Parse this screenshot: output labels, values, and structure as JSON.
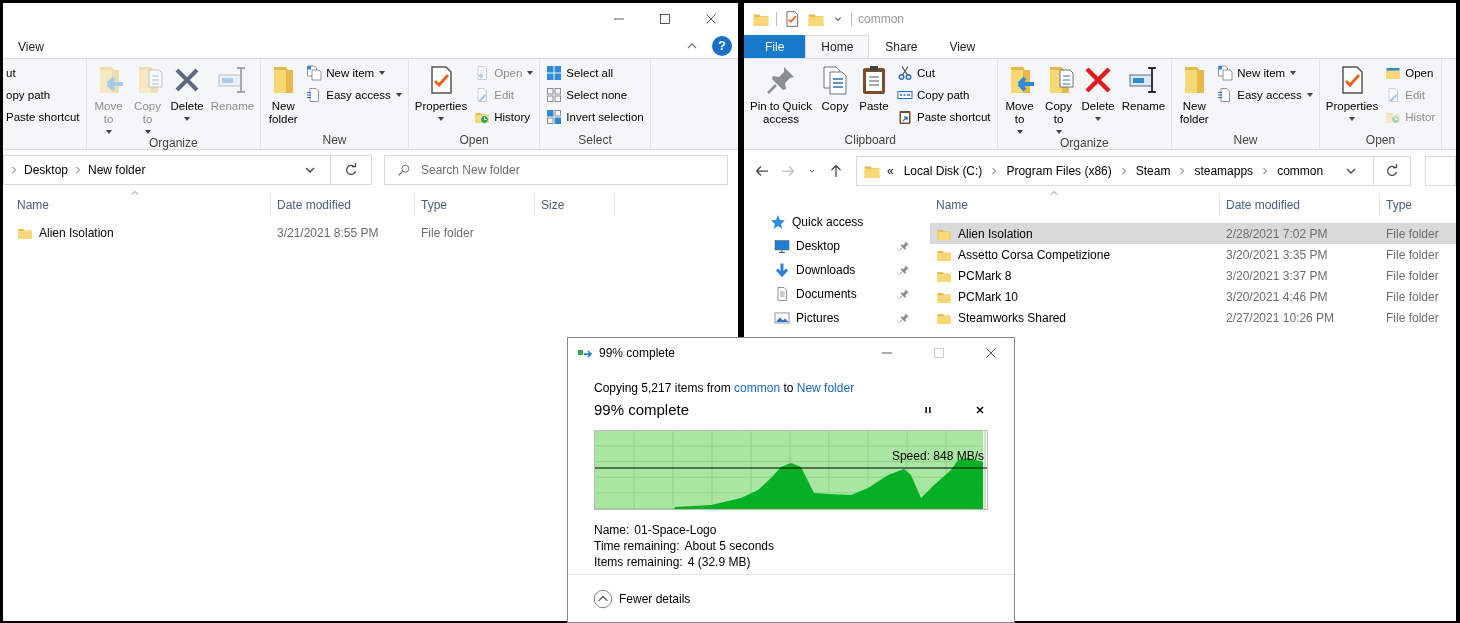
{
  "left_window": {
    "tabs": [
      {
        "label": "View",
        "selected": false
      }
    ],
    "help_label": "?",
    "ribbon_groups": [
      {
        "items": [
          {
            "kind": "small",
            "label": "ut",
            "disabled": false,
            "dropdown": false
          },
          {
            "kind": "small",
            "label": "opy path",
            "disabled": false,
            "dropdown": false
          },
          {
            "kind": "small",
            "label": "Paste shortcut",
            "disabled": false,
            "dropdown": false
          }
        ]
      },
      {
        "label": "Organize",
        "items": [
          {
            "kind": "large",
            "label": "Move\nto",
            "disabled": true,
            "dropdown": true
          },
          {
            "kind": "large",
            "label": "Copy\nto",
            "disabled": true,
            "dropdown": true
          },
          {
            "kind": "large",
            "label": "Delete",
            "disabled": false,
            "dropdown": true
          },
          {
            "kind": "large",
            "label": "Rename",
            "disabled": true,
            "dropdown": false
          }
        ]
      },
      {
        "label": "New",
        "items": [
          {
            "kind": "large",
            "label": "New\nfolder",
            "disabled": false,
            "dropdown": false
          },
          {
            "kind": "small",
            "label": "New item",
            "disabled": false,
            "dropdown": true
          },
          {
            "kind": "small",
            "label": "Easy access",
            "disabled": false,
            "dropdown": true
          }
        ]
      },
      {
        "label": "Open",
        "items": [
          {
            "kind": "large",
            "label": "Properties",
            "disabled": false,
            "dropdown": true
          },
          {
            "kind": "small",
            "label": "Open",
            "disabled": true,
            "dropdown": true
          },
          {
            "kind": "small",
            "label": "Edit",
            "disabled": true,
            "dropdown": false
          },
          {
            "kind": "small",
            "label": "History",
            "disabled": false,
            "dropdown": false
          }
        ]
      },
      {
        "label": "Select",
        "items": [
          {
            "kind": "small",
            "label": "Select all",
            "disabled": false,
            "dropdown": false
          },
          {
            "kind": "small",
            "label": "Select none",
            "disabled": false,
            "dropdown": false
          },
          {
            "kind": "small",
            "label": "Invert selection",
            "disabled": false,
            "dropdown": false
          }
        ]
      }
    ],
    "crumbs": [
      "Desktop",
      "New folder"
    ],
    "search": {
      "placeholder": "Search New folder"
    },
    "columns": [
      "Name",
      "Date modified",
      "Type",
      "Size"
    ],
    "rows": [
      {
        "name": "Alien Isolation",
        "date": "3/21/2021 8:55 PM",
        "type": "File folder",
        "selected": false
      }
    ]
  },
  "right_window": {
    "title": "common",
    "tabs": [
      {
        "label": "File",
        "kind": "file",
        "selected": false
      },
      {
        "label": "Home",
        "kind": "tab",
        "selected": true
      },
      {
        "label": "Share",
        "kind": "tab",
        "selected": false
      },
      {
        "label": "View",
        "kind": "tab",
        "selected": false
      }
    ],
    "ribbon_groups": [
      {
        "label": "Clipboard",
        "items": [
          {
            "kind": "large",
            "label": "Pin to Quick\naccess",
            "disabled": false,
            "dropdown": false
          },
          {
            "kind": "large",
            "label": "Copy",
            "disabled": false,
            "dropdown": false
          },
          {
            "kind": "large",
            "label": "Paste",
            "disabled": false,
            "dropdown": false
          },
          {
            "kind": "small",
            "label": "Cut",
            "disabled": false,
            "dropdown": false
          },
          {
            "kind": "small",
            "label": "Copy path",
            "disabled": false,
            "dropdown": false
          },
          {
            "kind": "small",
            "label": "Paste shortcut",
            "disabled": false,
            "dropdown": false
          }
        ]
      },
      {
        "label": "Organize",
        "items": [
          {
            "kind": "large",
            "label": "Move\nto",
            "disabled": false,
            "dropdown": true
          },
          {
            "kind": "large",
            "label": "Copy\nto",
            "disabled": false,
            "dropdown": true
          },
          {
            "kind": "large",
            "label": "Delete",
            "disabled": false,
            "dropdown": true
          },
          {
            "kind": "large",
            "label": "Rename",
            "disabled": false,
            "dropdown": false
          }
        ]
      },
      {
        "label": "New",
        "items": [
          {
            "kind": "large",
            "label": "New\nfolder",
            "disabled": false,
            "dropdown": false
          },
          {
            "kind": "small",
            "label": "New item",
            "disabled": false,
            "dropdown": true
          },
          {
            "kind": "small",
            "label": "Easy access",
            "disabled": false,
            "dropdown": true
          }
        ]
      },
      {
        "label": "Open",
        "items": [
          {
            "kind": "large",
            "label": "Properties",
            "disabled": false,
            "dropdown": true
          },
          {
            "kind": "small",
            "label": "Open",
            "disabled": false,
            "dropdown": false
          },
          {
            "kind": "small",
            "label": "Edit",
            "disabled": true,
            "dropdown": false
          },
          {
            "kind": "small",
            "label": "Histor",
            "disabled": true,
            "dropdown": false
          }
        ]
      }
    ],
    "nav_buttons": [
      {
        "kind": "back",
        "disabled": false
      },
      {
        "kind": "forward",
        "disabled": true
      },
      {
        "kind": "recent",
        "disabled": false
      },
      {
        "kind": "up",
        "disabled": false
      }
    ],
    "overflow_label": "«",
    "crumbs": [
      "Local Disk (C:)",
      "Program Files (x86)",
      "Steam",
      "steamapps",
      "common"
    ],
    "sidebar": {
      "header": "Quick access",
      "items": [
        {
          "label": "Desktop",
          "pinned": true
        },
        {
          "label": "Downloads",
          "pinned": true
        },
        {
          "label": "Documents",
          "pinned": true
        },
        {
          "label": "Pictures",
          "pinned": true
        }
      ]
    },
    "columns": [
      "Name",
      "Date modified",
      "Type"
    ],
    "rows": [
      {
        "name": "Alien Isolation",
        "date": "2/28/2021 7:02 PM",
        "type": "File folder",
        "selected": true
      },
      {
        "name": "Assetto Corsa Competizione",
        "date": "3/20/2021 3:35 PM",
        "type": "File folder",
        "selected": false
      },
      {
        "name": "PCMark 8",
        "date": "3/20/2021 3:37 PM",
        "type": "File folder",
        "selected": false
      },
      {
        "name": "PCMark 10",
        "date": "3/20/2021 4:46 PM",
        "type": "File folder",
        "selected": false
      },
      {
        "name": "Steamworks Shared",
        "date": "2/27/2021 10:26 PM",
        "type": "File folder",
        "selected": false
      }
    ]
  },
  "copy_dialog": {
    "title": "99% complete",
    "maximize_disabled": true,
    "message": {
      "before": "Copying 5,217 items from",
      "source": "common",
      "middle": "to",
      "target": "New folder"
    },
    "heading": "99% complete",
    "progress": {
      "level": 0.99
    },
    "speed": "Speed: 848 MB/s",
    "details": [
      {
        "label": "Name:",
        "value": "01-Space-Logo"
      },
      {
        "label": "Time remaining:",
        "value": "About 5 seconds"
      },
      {
        "label": "Items remaining:",
        "value": "4 (32.9 MB)"
      }
    ],
    "toggle": "Fewer details"
  }
}
